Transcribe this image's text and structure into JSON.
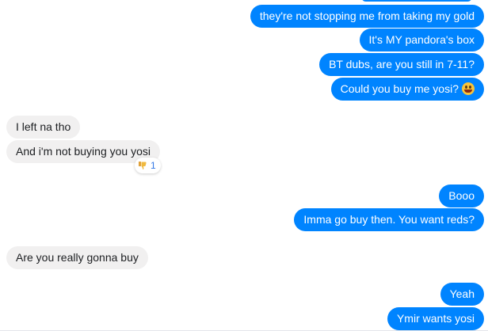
{
  "messages": [
    {
      "id": "m1",
      "dir": "out",
      "text": "they're not stopping me from taking my gold"
    },
    {
      "id": "m2",
      "dir": "out",
      "text": "It's MY pandora's box"
    },
    {
      "id": "m3",
      "dir": "out",
      "text": "BT dubs, are you still in 7-11?"
    },
    {
      "id": "m4",
      "dir": "out",
      "text": "Could you buy me yosi?",
      "emoji": "grinning-face-emoji"
    },
    {
      "id": "m5",
      "dir": "in",
      "text": "I left na tho"
    },
    {
      "id": "m6",
      "dir": "in",
      "text": "And i'm not buying you yosi",
      "reaction": {
        "icon": "thumbs-down-icon",
        "count": "1"
      }
    },
    {
      "id": "m7",
      "dir": "out",
      "text": "Booo"
    },
    {
      "id": "m8",
      "dir": "out",
      "text": "Imma go buy then. You want reds?"
    },
    {
      "id": "m9",
      "dir": "in",
      "text": "Are you really gonna buy"
    },
    {
      "id": "m10",
      "dir": "out",
      "text": "Yeah"
    },
    {
      "id": "m11",
      "dir": "out",
      "text": "Ymir wants yosi"
    }
  ],
  "colors": {
    "outgoing_bubble": "#0084ff",
    "incoming_bubble": "#f1f0f0",
    "reaction_count": "#3578e5"
  }
}
